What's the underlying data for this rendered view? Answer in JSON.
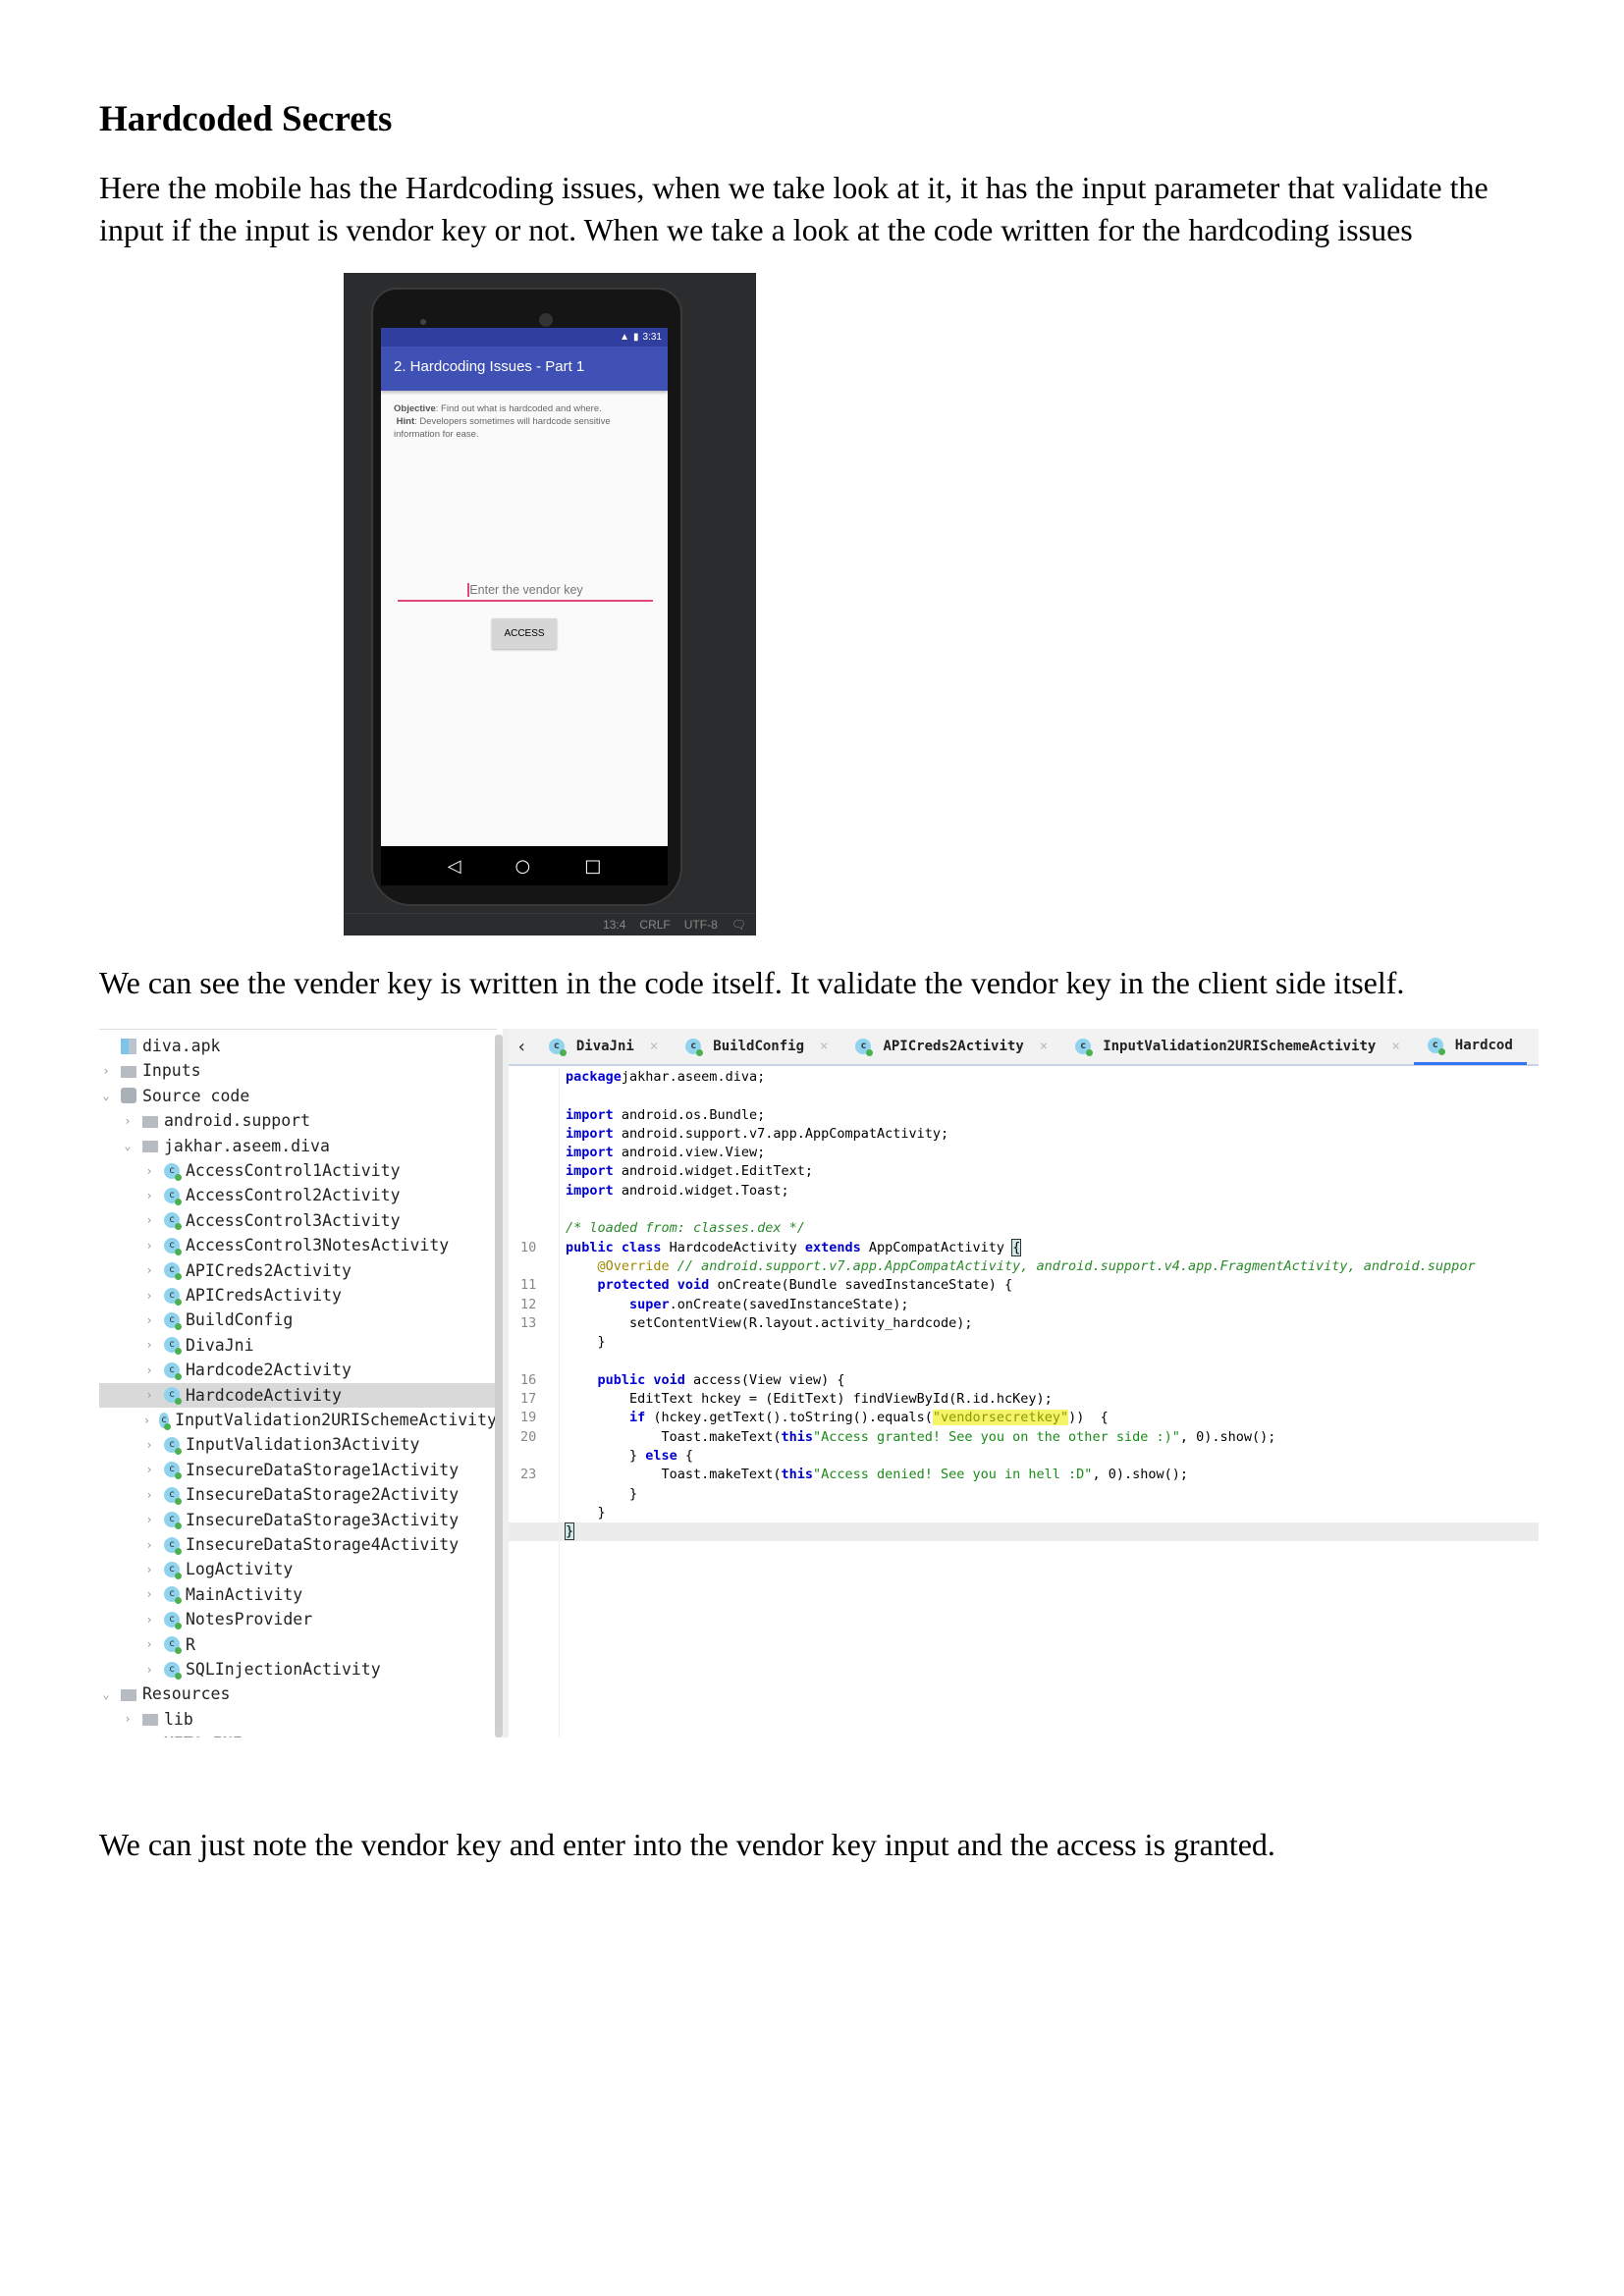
{
  "heading": "Hardcoded Secrets",
  "para1": "Here the mobile has the Hardcoding issues, when we take look at it, it has the input parameter that validate the input if the input is vendor key or not. When we take a look at the code written for the hardcoding issues",
  "para2": "We can see the vender key is written in the code itself. It validate the vendor key in the client side itself.",
  "para3": "We can just note the vendor key and enter into the vendor key input and the access is granted.",
  "phone": {
    "time": "3:31",
    "title": "2. Hardcoding Issues - Part 1",
    "objective_label": "Objective",
    "objective": ": Find out what is hardcoded and where.",
    "hint_label": "Hint",
    "hint": ": Developers sometimes will hardcode sensitive information for ease.",
    "placeholder": "Enter the vendor key",
    "button": "ACCESS",
    "nav": [
      "◁",
      "○",
      "□"
    ],
    "status": [
      "13:4",
      "CRLF",
      "UTF-8"
    ]
  },
  "tree": [
    {
      "label": "diva.apk",
      "icon": "apk-icon",
      "level": 0,
      "arrow": ""
    },
    {
      "label": "Inputs",
      "icon": "folder-inputs-icon",
      "level": 0,
      "arrow": "›"
    },
    {
      "label": "Source code",
      "icon": "package-icon",
      "level": 0,
      "arrow": "⌄"
    },
    {
      "label": "android.support",
      "icon": "folder-icon",
      "level": 1,
      "arrow": "›"
    },
    {
      "label": "jakhar.aseem.diva",
      "icon": "folder-icon",
      "level": 1,
      "arrow": "⌄"
    },
    {
      "label": "AccessControl1Activity",
      "icon": "class-icon",
      "level": 2,
      "arrow": "›"
    },
    {
      "label": "AccessControl2Activity",
      "icon": "class-icon",
      "level": 2,
      "arrow": "›"
    },
    {
      "label": "AccessControl3Activity",
      "icon": "class-icon",
      "level": 2,
      "arrow": "›"
    },
    {
      "label": "AccessControl3NotesActivity",
      "icon": "class-icon",
      "level": 2,
      "arrow": "›"
    },
    {
      "label": "APICreds2Activity",
      "icon": "class-icon",
      "level": 2,
      "arrow": "›"
    },
    {
      "label": "APICredsActivity",
      "icon": "class-icon",
      "level": 2,
      "arrow": "›"
    },
    {
      "label": "BuildConfig",
      "icon": "class-icon",
      "level": 2,
      "arrow": "›"
    },
    {
      "label": "DivaJni",
      "icon": "class-icon",
      "level": 2,
      "arrow": "›"
    },
    {
      "label": "Hardcode2Activity",
      "icon": "class-icon",
      "level": 2,
      "arrow": "›"
    },
    {
      "label": "HardcodeActivity",
      "icon": "class-icon",
      "level": 2,
      "arrow": "›",
      "selected": true
    },
    {
      "label": "InputValidation2URISchemeActivity",
      "icon": "class-icon",
      "level": 2,
      "arrow": "›"
    },
    {
      "label": "InputValidation3Activity",
      "icon": "class-icon",
      "level": 2,
      "arrow": "›"
    },
    {
      "label": "InsecureDataStorage1Activity",
      "icon": "class-icon",
      "level": 2,
      "arrow": "›"
    },
    {
      "label": "InsecureDataStorage2Activity",
      "icon": "class-icon",
      "level": 2,
      "arrow": "›"
    },
    {
      "label": "InsecureDataStorage3Activity",
      "icon": "class-icon",
      "level": 2,
      "arrow": "›"
    },
    {
      "label": "InsecureDataStorage4Activity",
      "icon": "class-icon",
      "level": 2,
      "arrow": "›"
    },
    {
      "label": "LogActivity",
      "icon": "class-icon",
      "level": 2,
      "arrow": "›"
    },
    {
      "label": "MainActivity",
      "icon": "class-icon",
      "level": 2,
      "arrow": "›"
    },
    {
      "label": "NotesProvider",
      "icon": "class-icon",
      "level": 2,
      "arrow": "›"
    },
    {
      "label": "R",
      "icon": "class-icon",
      "level": 2,
      "arrow": "›"
    },
    {
      "label": "SQLInjectionActivity",
      "icon": "class-icon",
      "level": 2,
      "arrow": "›"
    },
    {
      "label": "Resources",
      "icon": "folder-inputs-icon",
      "level": 0,
      "arrow": "⌄"
    },
    {
      "label": "lib",
      "icon": "folder-icon",
      "level": 1,
      "arrow": "›"
    },
    {
      "label": "META-INF",
      "icon": "folder-icon",
      "level": 1,
      "arrow": "›"
    }
  ],
  "tabs": [
    {
      "label": "DivaJni"
    },
    {
      "label": "BuildConfig"
    },
    {
      "label": "APICreds2Activity"
    },
    {
      "label": "InputValidation2URISchemeActivity"
    },
    {
      "label": "Hardcod",
      "active": true
    }
  ],
  "code": [
    {
      "n": "",
      "tk": [
        [
          "kw",
          "package"
        ],
        [
          "",
          "jakhar.aseem.diva;"
        ]
      ]
    },
    {
      "n": "",
      "tk": []
    },
    {
      "n": "",
      "tk": [
        [
          "kw",
          "import"
        ],
        [
          "",
          " android.os.Bundle;"
        ]
      ]
    },
    {
      "n": "",
      "tk": [
        [
          "kw",
          "import"
        ],
        [
          "",
          " android.support.v7.app.AppCompatActivity;"
        ]
      ]
    },
    {
      "n": "",
      "tk": [
        [
          "kw",
          "import"
        ],
        [
          "",
          " android.view.View;"
        ]
      ]
    },
    {
      "n": "",
      "tk": [
        [
          "kw",
          "import"
        ],
        [
          "",
          " android.widget.EditText;"
        ]
      ]
    },
    {
      "n": "",
      "tk": [
        [
          "kw",
          "import"
        ],
        [
          "",
          " android.widget.Toast;"
        ]
      ]
    },
    {
      "n": "",
      "tk": []
    },
    {
      "n": "",
      "tk": [
        [
          "cm",
          "/* loaded from: classes.dex */"
        ]
      ]
    },
    {
      "n": "10",
      "tk": [
        [
          "kw",
          "public class"
        ],
        [
          "",
          " HardcodeActivity "
        ],
        [
          "kw",
          "extends"
        ],
        [
          "",
          " AppCompatActivity "
        ],
        [
          "br",
          "{"
        ]
      ]
    },
    {
      "n": "",
      "tk": [
        [
          "",
          "    "
        ],
        [
          "an",
          "@Override"
        ],
        [
          "cm",
          " // android.support.v7.app.AppCompatActivity, android.support.v4.app.FragmentActivity, android.suppor"
        ]
      ]
    },
    {
      "n": "11",
      "tk": [
        [
          "",
          "    "
        ],
        [
          "kw",
          "protected void"
        ],
        [
          "",
          " onCreate(Bundle savedInstanceState) {"
        ]
      ]
    },
    {
      "n": "12",
      "tk": [
        [
          "",
          "        "
        ],
        [
          "kw",
          "super"
        ],
        [
          "",
          ".onCreate(savedInstanceState);"
        ]
      ]
    },
    {
      "n": "13",
      "tk": [
        [
          "",
          "        setContentView(R.layout.activity_hardcode);"
        ]
      ]
    },
    {
      "n": "",
      "tk": [
        [
          "",
          "    }"
        ]
      ]
    },
    {
      "n": "",
      "tk": []
    },
    {
      "n": "16",
      "tk": [
        [
          "",
          "    "
        ],
        [
          "kw",
          "public void"
        ],
        [
          "",
          " access(View view) {"
        ]
      ]
    },
    {
      "n": "17",
      "tk": [
        [
          "",
          "        EditText hckey = (EditText) findViewById(R.id.hcKey);"
        ]
      ]
    },
    {
      "n": "19",
      "tk": [
        [
          "",
          "        "
        ],
        [
          "kw",
          "if"
        ],
        [
          "",
          " (hckey.getText().toString().equals("
        ],
        [
          "hl",
          "\"vendorsecretkey\""
        ],
        [
          "",
          "))  {"
        ]
      ]
    },
    {
      "n": "20",
      "tk": [
        [
          "",
          "            Toast.makeText("
        ],
        [
          "kw",
          "this"
        ],
        [
          ",  "
        ],
        [
          "st",
          "\"Access granted! See you on the other side :)\""
        ],
        [
          "",
          ", 0).show();"
        ]
      ]
    },
    {
      "n": "",
      "tk": [
        [
          "",
          "        } "
        ],
        [
          "kw",
          "else"
        ],
        [
          "",
          " {"
        ]
      ]
    },
    {
      "n": "23",
      "tk": [
        [
          "",
          "            Toast.makeText("
        ],
        [
          "kw",
          "this"
        ],
        [
          ",  "
        ],
        [
          "st",
          "\"Access denied! See you in hell :D\""
        ],
        [
          "",
          ", 0).show();"
        ]
      ]
    },
    {
      "n": "",
      "tk": [
        [
          "",
          "        }"
        ]
      ]
    },
    {
      "n": "",
      "tk": [
        [
          "",
          "    }"
        ]
      ]
    },
    {
      "n": "",
      "cur": true,
      "tk": [
        [
          "br",
          "}"
        ]
      ]
    }
  ]
}
